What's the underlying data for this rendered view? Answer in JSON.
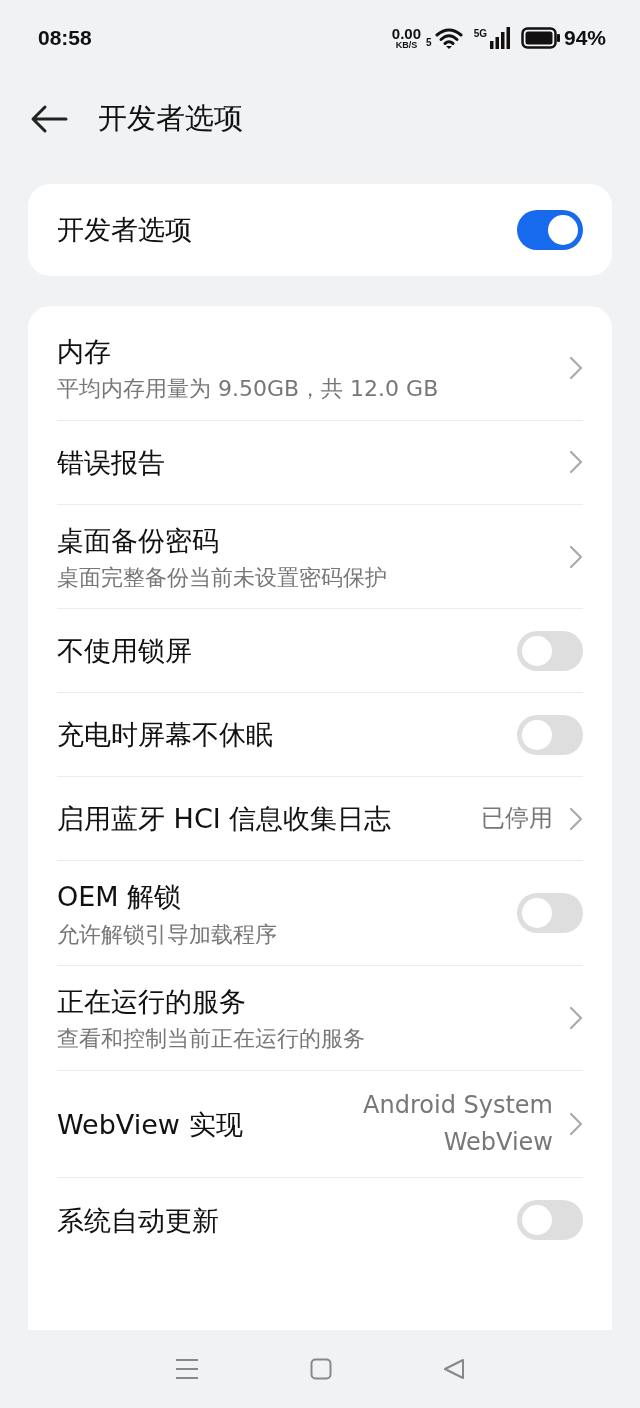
{
  "status_bar": {
    "time": "08:58",
    "speed": "0.00",
    "speed_unit": "KB/S",
    "wifi_label": "5",
    "network": "5G",
    "battery": "94%"
  },
  "header": {
    "title": "开发者选项"
  },
  "master": {
    "label": "开发者选项",
    "on": true
  },
  "settings": [
    {
      "kind": "link",
      "title": "内存",
      "subtitle": "平均内存用量为 9.50GB，共 12.0 GB"
    },
    {
      "kind": "link",
      "title": "错误报告"
    },
    {
      "kind": "link",
      "title": "桌面备份密码",
      "subtitle": "桌面完整备份当前未设置密码保护"
    },
    {
      "kind": "switch",
      "title": "不使用锁屏",
      "on": false
    },
    {
      "kind": "switch",
      "title": "充电时屏幕不休眠",
      "on": false
    },
    {
      "kind": "link",
      "title": "启用蓝牙 HCI 信息收集日志",
      "value": "已停用"
    },
    {
      "kind": "switch",
      "title": "OEM 解锁",
      "subtitle": "允许解锁引导加载程序",
      "on": false
    },
    {
      "kind": "link",
      "title": "正在运行的服务",
      "subtitle": "查看和控制当前正在运行的服务"
    },
    {
      "kind": "link",
      "title": "WebView 实现",
      "value": "Android System WebView"
    },
    {
      "kind": "switch",
      "title": "系统自动更新",
      "on": false
    }
  ]
}
